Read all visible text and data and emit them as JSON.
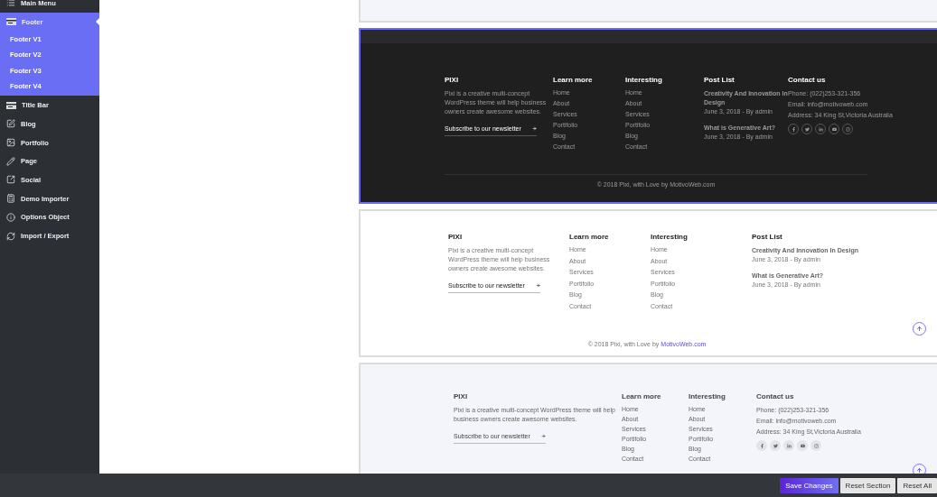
{
  "sidebar": {
    "items": [
      {
        "label": "Main Menu",
        "selected": false
      },
      {
        "label": "Footer",
        "selected": true,
        "expanded": true,
        "children": [
          {
            "label": "Footer V1",
            "selected": false
          },
          {
            "label": "Footer V2",
            "selected": false
          },
          {
            "label": "Footer V3",
            "selected": false
          },
          {
            "label": "Footer V4",
            "selected": false
          }
        ]
      },
      {
        "label": "Title Bar",
        "selected": false
      },
      {
        "label": "Blog",
        "selected": false
      },
      {
        "label": "Portfolio",
        "selected": false
      },
      {
        "label": "Page",
        "selected": false
      },
      {
        "label": "Social",
        "selected": false
      },
      {
        "label": "Demo Importer",
        "selected": false
      },
      {
        "label": "Options Object",
        "selected": false
      },
      {
        "label": "Import / Export",
        "selected": false
      }
    ]
  },
  "previews": [
    {
      "kind": "dark",
      "selected": true,
      "about": {
        "title": "PIXI",
        "text": "Pixi is a creative multi-concept WordPress theme will help business owners create awesome websites.",
        "newsletter": {
          "placeholder": "Subscribe to our newsletter"
        }
      },
      "link_columns": [
        {
          "title": "Learn more",
          "links": [
            "Home",
            "About",
            "Services",
            "Portifolio",
            "Blog",
            "Contact"
          ]
        },
        {
          "title": "Interesting",
          "links": [
            "Home",
            "About",
            "Services",
            "Portifolio",
            "Blog",
            "Contact"
          ]
        }
      ],
      "post_list": {
        "title": "Post List",
        "posts": [
          {
            "title": "Creativity And Innovation In Design",
            "meta": "June 3, 2018 - By admin"
          },
          {
            "title": "What is Generative Art?",
            "meta": "June 3, 2018 - By admin"
          }
        ]
      },
      "contact": {
        "title": "Contact us",
        "lines": [
          "Phone: (022)253-321-356",
          "Email: info@motivoweb.com",
          "Address: 34 King St,Victoria Australia"
        ]
      },
      "copyright": {
        "text": "© 2018 Pixi, with Love by MotivoWeb.com"
      },
      "back_to_top": false
    },
    {
      "kind": "light",
      "selected": false,
      "about": {
        "title": "PIXI",
        "text": "Pixi is a creative multi-concept WordPress theme will help business owners create awesome websites.",
        "newsletter": {
          "placeholder": "Subscribe to our newsletter"
        }
      },
      "link_columns": [
        {
          "title": "Learn more",
          "links": [
            "Home",
            "About",
            "Services",
            "Portifolio",
            "Blog",
            "Contact"
          ]
        },
        {
          "title": "Interesting",
          "links": [
            "Home",
            "About",
            "Services",
            "Portifolio",
            "Blog",
            "Contact"
          ]
        }
      ],
      "post_list": {
        "title": "Post List",
        "posts": [
          {
            "title": "Creativity And Innovation In Design",
            "meta": "June 3, 2018 - By admin"
          },
          {
            "title": "What is Generative Art?",
            "meta": "June 3, 2018 - By admin"
          }
        ]
      },
      "copyright": {
        "text": "© 2018 Pixi, with Love by ",
        "link": "MotivoWeb.com"
      },
      "back_to_top": true
    },
    {
      "kind": "gray",
      "selected": false,
      "about": {
        "title": "PIXI",
        "text": "Pixi is a creative multi-concept WordPress theme will help business owners create awesome websites.",
        "newsletter": {
          "placeholder": "Subscribe to our newsletter"
        }
      },
      "link_columns": [
        {
          "title": "Learn more",
          "links": [
            "Home",
            "About",
            "Services",
            "Portifolio",
            "Blog",
            "Contact"
          ]
        },
        {
          "title": "Interesting",
          "links": [
            "Home",
            "About",
            "Services",
            "Portifolio",
            "Blog",
            "Contact"
          ]
        }
      ],
      "contact": {
        "title": "Contact us",
        "lines": [
          "Phone: (022)253-321-356",
          "Email: info@motivoweb.com",
          "Address: 34 King St,Victoria Australia"
        ]
      },
      "back_to_top": true
    }
  ],
  "actions": [
    {
      "label": "Save Changes",
      "kind": "primary"
    },
    {
      "label": "Reset Section",
      "kind": "secondary"
    },
    {
      "label": "Reset All",
      "kind": "secondary"
    }
  ]
}
